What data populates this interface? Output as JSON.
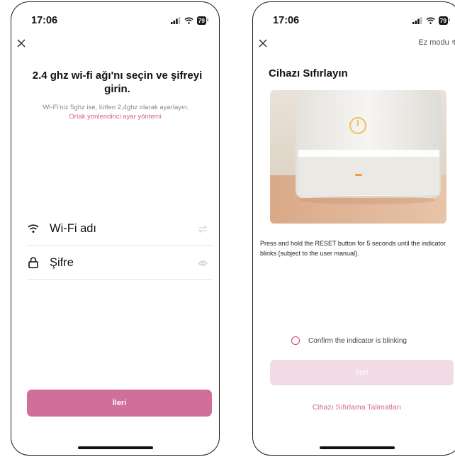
{
  "left": {
    "status": {
      "time": "17:06",
      "battery": "79"
    },
    "title": "2.4 ghz wi-fi ağı'nı seçin ve şifreyi girin.",
    "subtitle": "Wi-Fi'niz 5ghz ise, lütfen 2,4ghz olarak ayarlayın.",
    "link": "Ortak yönlendirici ayar yöntemi",
    "wifi_label": "Wi-Fi adı",
    "password_label": "Şifre",
    "next_button": "İleri"
  },
  "right": {
    "status": {
      "time": "17:06",
      "battery": "79"
    },
    "mode_label": "Ez modu ≑",
    "title": "Cihazı Sıfırlayın",
    "description": "Press and hold the RESET button for 5 seconds until the indicator blinks (subject to the user manual).",
    "confirm_label": "Confirm the indicator is blinking",
    "next_button": "İleri",
    "reset_link": "Cihazı Sıfırlama Talimatları"
  },
  "colors": {
    "accent": "#cf6f9a",
    "link": "#d4648f",
    "disabled_button": "#f1dbe5",
    "radio": "#d73a5a"
  },
  "icons": [
    "close-icon",
    "signal-icon",
    "wifi-icon",
    "lock-icon",
    "swap-icon",
    "eye-icon",
    "power-icon"
  ]
}
